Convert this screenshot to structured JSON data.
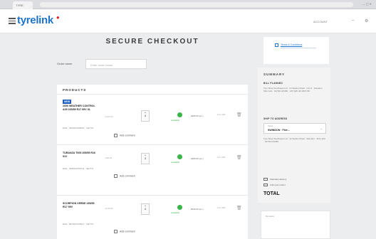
{
  "browser": {
    "tab_label": "TYRE",
    "window_controls": "— ▢ ✕"
  },
  "header": {
    "logo_text": "tyrelink",
    "logo_mark": "●",
    "account_label": "ACCOUNT",
    "icons": [
      "user-icon",
      "settings-icon"
    ]
  },
  "page": {
    "title": "SECURE CHECKOUT",
    "order_ref_label": "Order name",
    "order_ref_placeholder": "Enter order name"
  },
  "products": {
    "title": "PRODUCTS",
    "items": [
      {
        "badge": "NEW",
        "name": "2690 WEATHER CONTROL A05 205/55 R17 95V XL",
        "meta": "EAN - 4250427406051 · NETTO",
        "price": "£120.00",
        "qty": "4",
        "availability": "Available",
        "line_total": "£480.00 (ex.)",
        "extra": "incl. VAT",
        "comment_label": "Add comment"
      },
      {
        "badge": "",
        "name": "TURANZA T005 205/55 R16 91V",
        "meta": "EAN - 3286340759711 · NETTO",
        "price": "£95.00",
        "qty": "4",
        "availability": "Available",
        "line_total": "£380.00 (ex.)",
        "extra": "incl. VAT",
        "comment_label": "Add comment"
      },
      {
        "badge": "",
        "name": "SCORPION VERDE 235/55 R17 99V",
        "meta": "EAN - 8019227245917 · NETTO",
        "price": "£135.00",
        "qty": "4",
        "availability": "Available",
        "line_total": "£540.00 (ex.)",
        "extra": "incl. VAT",
        "comment_label": "Add comment"
      }
    ]
  },
  "sidebar": {
    "terms_link": "Terms & Conditions",
    "summary_title": "SUMMARY",
    "bill_heading": "BILL PLANNED",
    "bill_address": "Tyre Shop Southwest Ltd · 12 Station Road · Unit 4 · Swindon · SN1 1AA · 01793 123456 · VAT GB 123 4567 89",
    "ship_heading": "SHIP TO ADDRESS",
    "ship_small": "Select",
    "ship_value": "SWINDON · Flee...",
    "ship_address": "Tyre Shop Southwest Ltd · 12 Station Road · Swindon · SN1 1AA · 01793 123456",
    "opt1": "Standard delivery",
    "opt2": "Click and collect",
    "total_label": "TOTAL",
    "remarks_placeholder": "Remarks"
  }
}
